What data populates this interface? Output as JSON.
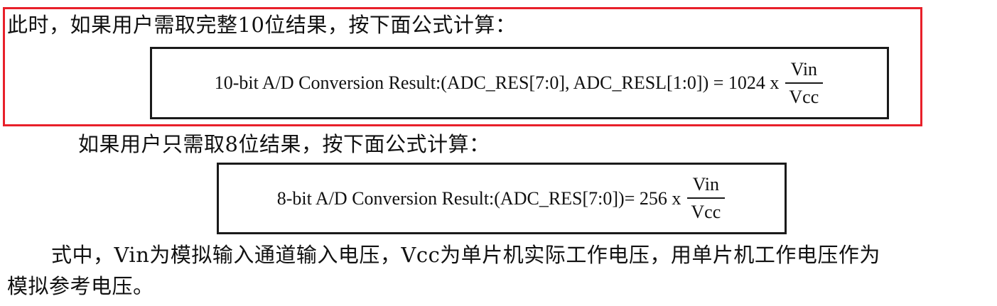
{
  "para1": {
    "text": "此时，如果用户需取完整10位结果，按下面公式计算："
  },
  "formula1": {
    "expr": "10-bit A/D Conversion Result:(ADC_RES[7:0], ADC_RESL[1:0]) = 1024 x",
    "numerator": "Vin",
    "denominator": "Vcc"
  },
  "para2": {
    "text": "如果用户只需取8位结果，按下面公式计算："
  },
  "formula2": {
    "expr": "8-bit A/D Conversion Result:(ADC_RES[7:0])= 256 x",
    "numerator": "Vin",
    "denominator": "Vcc"
  },
  "para3": {
    "line1": "式中，Vin为模拟输入通道输入电压，Vcc为单片机实际工作电压，用单片机工作电压作为",
    "line2": "模拟参考电压。"
  },
  "colors": {
    "highlight": "#e8202a",
    "border": "#1a1a1a",
    "text": "#111111"
  }
}
